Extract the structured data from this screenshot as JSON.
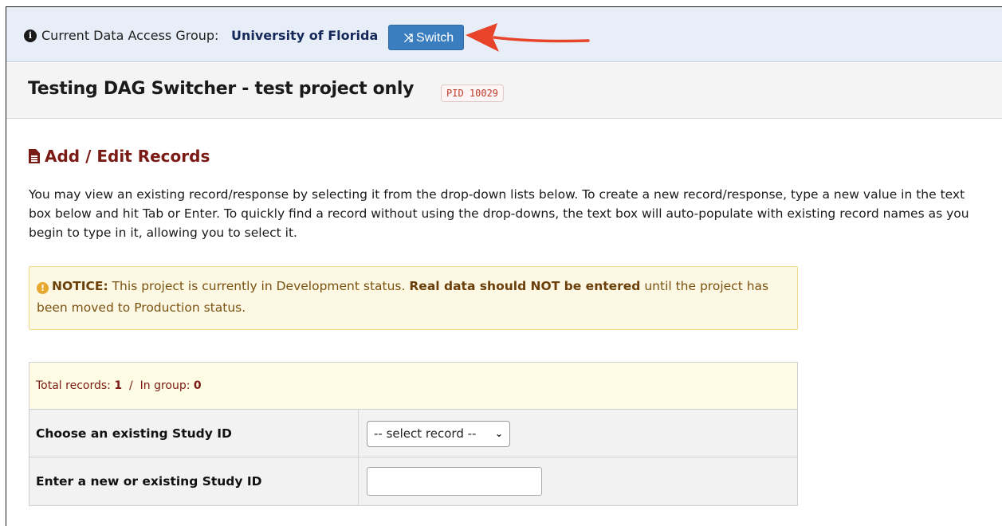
{
  "dag_bar": {
    "label": "Current Data Access Group:",
    "group": "University of Florida",
    "switch_label": "Switch"
  },
  "project": {
    "title": "Testing DAG Switcher - test project only",
    "pid": "PID 10029"
  },
  "section": {
    "title": "Add / Edit Records"
  },
  "intro_text": "You may view an existing record/response by selecting it from the drop-down lists below. To create a new record/response, type a new value in the text box below and hit Tab or Enter. To quickly find a record without using the drop-downs, the text box will auto-populate with existing record names as you begin to type in it, allowing you to select it.",
  "notice": {
    "prefix": "NOTICE:",
    "text1": "This project is currently in Development status.",
    "bold": "Real data should NOT be entered",
    "text2": "until the project has been moved to Production status."
  },
  "records": {
    "total_label": "Total records:",
    "total_value": "1",
    "separator": "/",
    "group_label": "In group:",
    "group_value": "0",
    "choose_label": "Choose an existing Study ID",
    "select_placeholder": "-- select record --",
    "enter_label": "Enter a new or existing Study ID",
    "enter_value": ""
  },
  "colors": {
    "dag_bar_bg": "#e8eef8",
    "switch_button": "#3a7ec0",
    "arrow": "#e8432b",
    "section_title": "#7a1a14",
    "notice_bg": "#fcf8e3"
  },
  "icons": [
    "info-icon",
    "shuffle-icon",
    "document-icon",
    "warning-icon",
    "chevron-down-icon",
    "arrow-annotation"
  ]
}
